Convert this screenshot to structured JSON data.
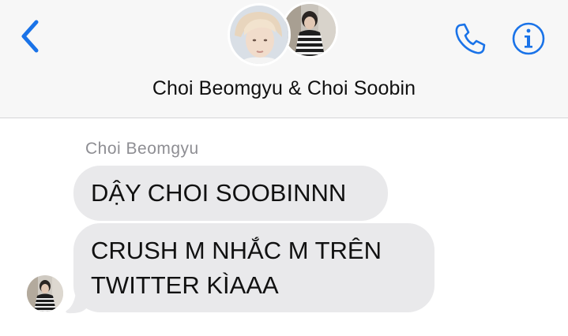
{
  "header": {
    "title": "Choi Beomgyu & Choi Soobin",
    "back_icon": "chevron-left-icon",
    "call_icon": "phone-icon",
    "info_icon": "info-icon",
    "accent_color": "#1a73e8"
  },
  "conversation": {
    "sender_name": "Choi Beomgyu",
    "messages": [
      {
        "text": "DẬY CHOI SOOBINNN"
      },
      {
        "line1": "CRUSH M NHẮC M TRÊN",
        "line2": "TWITTER KÌAAA"
      }
    ],
    "bubble_color": "#e9e9eb"
  }
}
